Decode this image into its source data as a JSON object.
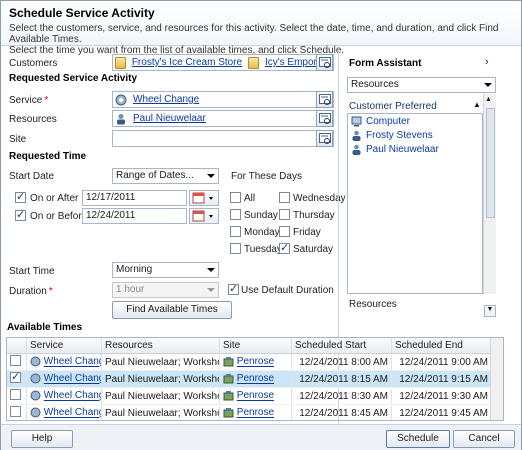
{
  "dialog": {
    "title": "Schedule Service Activity",
    "description_line1": "Select the customers, service, and resources for this activity. Select the date, time, and duration, and click Find Available Times.",
    "description_line2": "Select the time you want from the list of available times, and click Schedule."
  },
  "form": {
    "customers_label": "Customers",
    "customer1": "Frosty's Ice Cream Store",
    "customer2": "Icy's Emporium",
    "requested_service_activity": "Requested Service Activity",
    "service_label": "Service",
    "service_value": "Wheel Change",
    "resources_label": "Resources",
    "resources_value": "Paul Nieuwelaar",
    "site_label": "Site",
    "requested_time": "Requested Time",
    "start_date_label": "Start Date",
    "start_date_option": "Range of Dates...",
    "for_these_days": "For These Days",
    "on_or_after_label": "On or After",
    "on_or_after_value": "12/17/2011",
    "on_or_before_label": "On or Before",
    "on_or_before_value": "12/24/2011",
    "days": {
      "all": "All",
      "sunday": "Sunday",
      "monday": "Monday",
      "tuesday": "Tuesday",
      "wednesday": "Wednesday",
      "thursday": "Thursday",
      "friday": "Friday",
      "saturday": "Saturday"
    },
    "start_time_label": "Start Time",
    "start_time_value": "Morning",
    "duration_label": "Duration",
    "duration_value": "1 hour",
    "use_default_duration": "Use Default Duration",
    "find_available_times": "Find Available Times"
  },
  "assistant": {
    "title": "Form Assistant",
    "dropdown": "Resources",
    "customer_preferred": "Customer Preferred",
    "items": [
      "Computer",
      "Frosty Stevens",
      "Paul Nieuwelaar"
    ],
    "bottom_label": "Resources"
  },
  "available_times": {
    "title": "Available Times",
    "columns": [
      "Service",
      "Resources",
      "Site",
      "Scheduled Start",
      "Scheduled End"
    ],
    "rows": [
      {
        "service": "Wheel Chang",
        "resources": "Paul Nieuwelaar; Workshop",
        "site": "Penrose",
        "start": "12/24/2011 8:00 AM",
        "end": "12/24/2011 9:00 AM"
      },
      {
        "service": "Wheel Chang",
        "resources": "Paul Nieuwelaar; Workshop",
        "site": "Penrose",
        "start": "12/24/2011 8:15 AM",
        "end": "12/24/2011 9:15 AM"
      },
      {
        "service": "Wheel Chang",
        "resources": "Paul Nieuwelaar; Workshop",
        "site": "Penrose",
        "start": "12/24/2011 8:30 AM",
        "end": "12/24/2011 9:30 AM"
      },
      {
        "service": "Wheel Chang",
        "resources": "Paul Nieuwelaar; Workshop",
        "site": "Penrose",
        "start": "12/24/2011 8:45 AM",
        "end": "12/24/2011 9:45 AM"
      }
    ]
  },
  "footer": {
    "help": "Help",
    "schedule": "Schedule",
    "cancel": "Cancel"
  }
}
